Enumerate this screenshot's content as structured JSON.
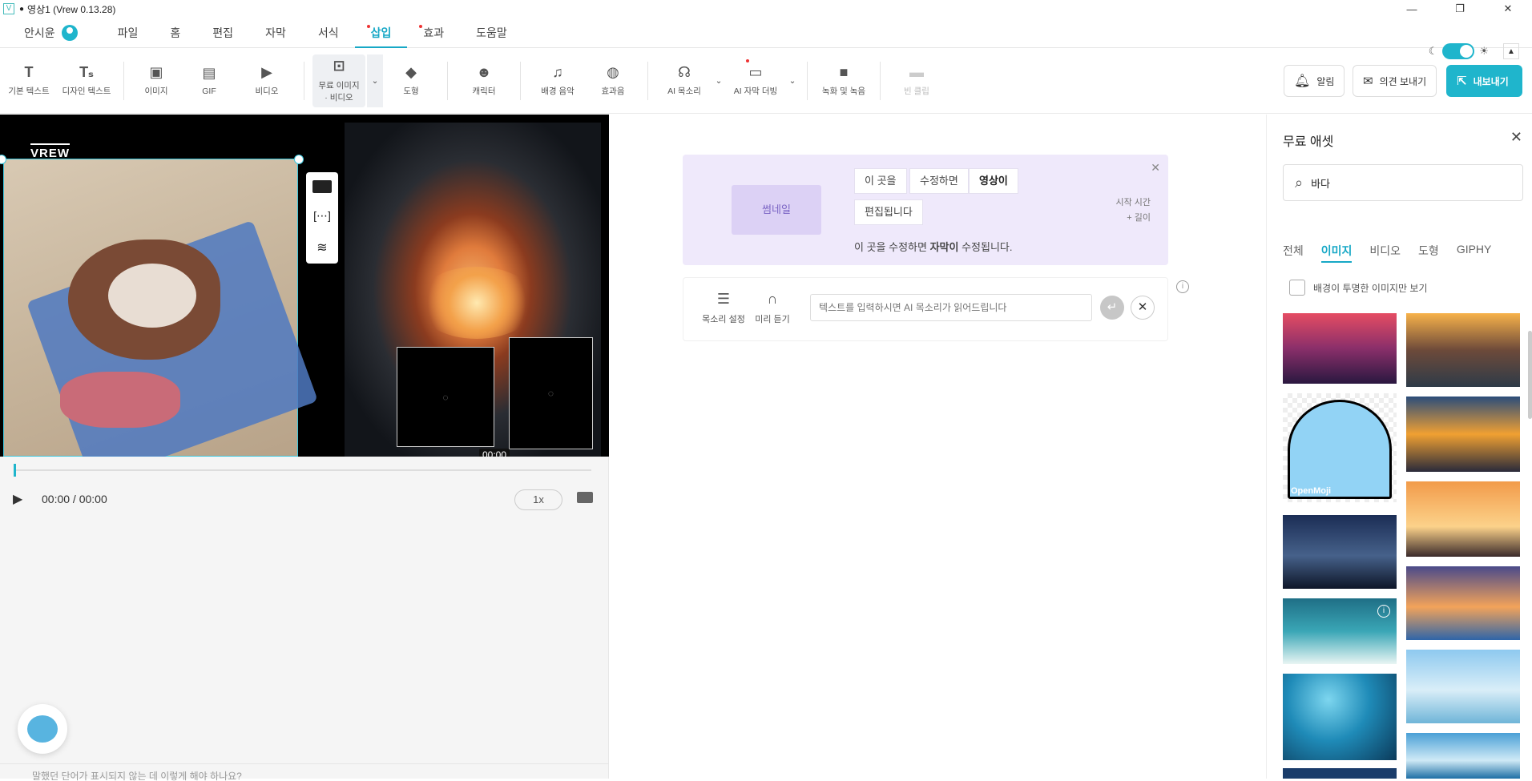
{
  "window": {
    "title": "영상1 (Vrew 0.13.28)",
    "minimize": "—",
    "restore": "❐",
    "close": "✕"
  },
  "menu": {
    "user": "안시윤",
    "items": [
      "파일",
      "홈",
      "편집",
      "자막",
      "서식",
      "삽입",
      "효과",
      "도움말"
    ],
    "active": "삽입"
  },
  "toolbar": {
    "tools": [
      "기본 텍스트",
      "디자인 텍스트",
      "이미지",
      "GIF",
      "비디오",
      "무료 이미지 · 비디오",
      "도형",
      "캐릭터",
      "배경 음악",
      "효과음",
      "AI 목소리",
      "AI 자막 더빙",
      "녹화 및 녹음",
      "빈 클립"
    ],
    "free_media_line1": "무료 이미지",
    "free_media_line2": "· 비디오",
    "notify": "알림",
    "feedback": "의견 보내기",
    "export": "내보내기"
  },
  "preview": {
    "logo": "VREW",
    "time_tooltip": "00:00"
  },
  "player": {
    "time": "00:00 / 00:00",
    "speed": "1x"
  },
  "clip": {
    "thumbnail": "썸네일",
    "words": [
      "이 곳을",
      "수정하면",
      "영상이",
      "편집됩니다"
    ],
    "caption_pre": "이 곳을 수정하면 ",
    "caption_bold": "자막이",
    "caption_post": " 수정됩니다.",
    "start_time": "시작 시간",
    "length": "+ 길이",
    "voice_settings": "목소리 설정",
    "preview_listen": "미리 듣기",
    "tts_placeholder": "텍스트를 입력하시면 AI 목소리가 읽어드립니다"
  },
  "assets": {
    "title": "무료 애셋",
    "search_value": "바다",
    "tabs": [
      "전체",
      "이미지",
      "비디오",
      "도형",
      "GIPHY"
    ],
    "active_tab": "이미지",
    "transparent_only": "배경이 투명한 이미지만 보기",
    "openmoji": "OpenMoji"
  },
  "colors": {
    "accent": "#1fb5cc",
    "clip_bg": "#efe9fb",
    "thumb": "#dcd1f5"
  },
  "footer_hint": "말했던 단어가 표시되지 않는 데 이렇게 해야 하나요?"
}
